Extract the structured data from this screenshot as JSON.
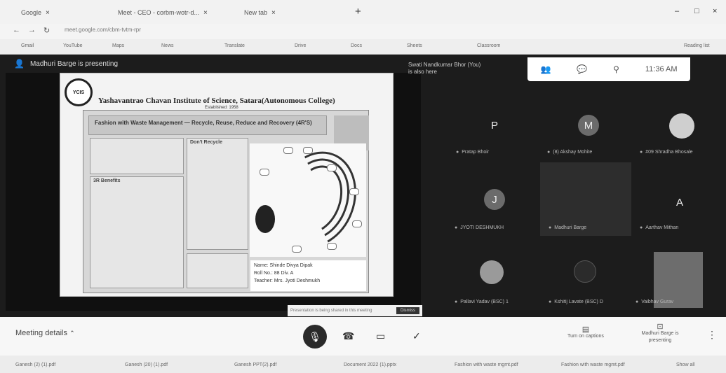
{
  "browser": {
    "tabs": [
      {
        "label": "Google",
        "close": "×"
      },
      {
        "label": "Meet - CEO - corbm-wotr-d...",
        "close": "×"
      },
      {
        "label": "New tab",
        "close": "×"
      }
    ],
    "new_tab": "+",
    "window_controls": [
      "–",
      "□",
      "×"
    ],
    "nav": [
      "←",
      "→",
      "↻"
    ],
    "url": "meet.google.com/cbm-tvtm-rpr",
    "bookmarks": [
      "Gmail",
      "YouTube",
      "Maps",
      "News",
      "Translate",
      "Drive",
      "Docs",
      "Sheets",
      "Classroom",
      "Reading list"
    ]
  },
  "meet": {
    "presenting_label": "Madhuri Barge is presenting",
    "pinned_name": "Swati Nandkumar Bhor (You)",
    "pinned_sub": "is also here",
    "clock": "11:36 AM",
    "slide": {
      "logo_text": "YCIS",
      "college": "Yashavantrao Chavan Institute of Science, Satara(Autonomous College)",
      "estd": "Established: 1958",
      "banner": "Fashion with Waste Management — Recycle, Reuse, Reduce and Recovery (4R'S)",
      "left_box_title": "3R Benefits",
      "mid_box_title": "Don't Recycle",
      "info_lines": [
        "Name: Shinde Divya Dipak",
        "Roll No.: 88 Div. A",
        "Teacher: Mrs. Jyoti Deshmukh"
      ]
    },
    "participants": [
      {
        "initial": "P",
        "name": "Pratap Bhoir"
      },
      {
        "initial": "M",
        "name": "(8) Akshay Mohite"
      },
      {
        "initial": "",
        "name": "#09 Shradha Bhosale"
      },
      {
        "initial": "J",
        "name": "JYOTI DESHMUKH"
      },
      {
        "initial": "",
        "name": "Madhuri Barge"
      },
      {
        "initial": "A",
        "name": "Aarthav Mithan"
      },
      {
        "initial": "",
        "name": "Pallavi Yadav (BSC) 1"
      },
      {
        "initial": "",
        "name": "Kshitij Lavate (BSC) D"
      },
      {
        "initial": "",
        "name": "Vaibhav Gurav"
      }
    ],
    "toast_text": "Presentation is being shared in this meeting",
    "toast_button": "Dismiss",
    "meeting_details": "Meeting details",
    "captions": "Turn on captions",
    "presenting_btn": "Madhuri Barge is presenting"
  },
  "downloads": [
    "Ganesh (2) (1).pdf",
    "Ganesh (20) (1).pdf",
    "Ganesh PPT(2).pdf",
    "Document 2022 (1).pptx",
    "Fashion with waste mgmt.pdf",
    "Fashion with waste mgmt.pdf",
    "Show all"
  ]
}
